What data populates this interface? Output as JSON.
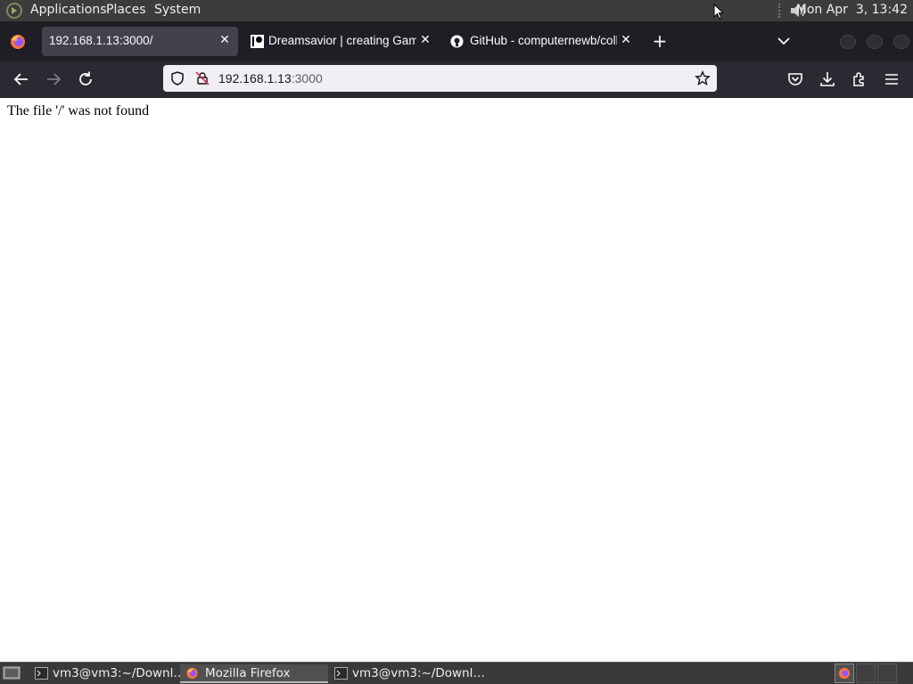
{
  "panel": {
    "menus": [
      "Applications",
      "Places",
      "System"
    ],
    "clock": "Mon Apr  3, 13:42"
  },
  "tabs": [
    {
      "label": "192.168.1.13:3000/",
      "active": true
    },
    {
      "label": "Dreamsavior | creating Gam",
      "active": false
    },
    {
      "label": "GitHub - computernewb/coll",
      "active": false
    }
  ],
  "urlbar": {
    "host": "192.168.1.13",
    "port": ":3000"
  },
  "content": {
    "message": "The file '/' was not found"
  },
  "taskbar": {
    "items": [
      {
        "label": "vm3@vm3:~/Downl…",
        "icon": "terminal-icon"
      },
      {
        "label": "Mozilla Firefox",
        "icon": "firefox-icon",
        "active": true
      },
      {
        "label": "vm3@vm3:~/Downl…",
        "icon": "terminal-icon"
      }
    ]
  },
  "colors": {
    "panel": "#3c3c3c",
    "tabstrip": "#1f1e25",
    "active_tab": "#42414d",
    "navbar": "#2b2a33",
    "urlbar": "#f0f0f4"
  }
}
